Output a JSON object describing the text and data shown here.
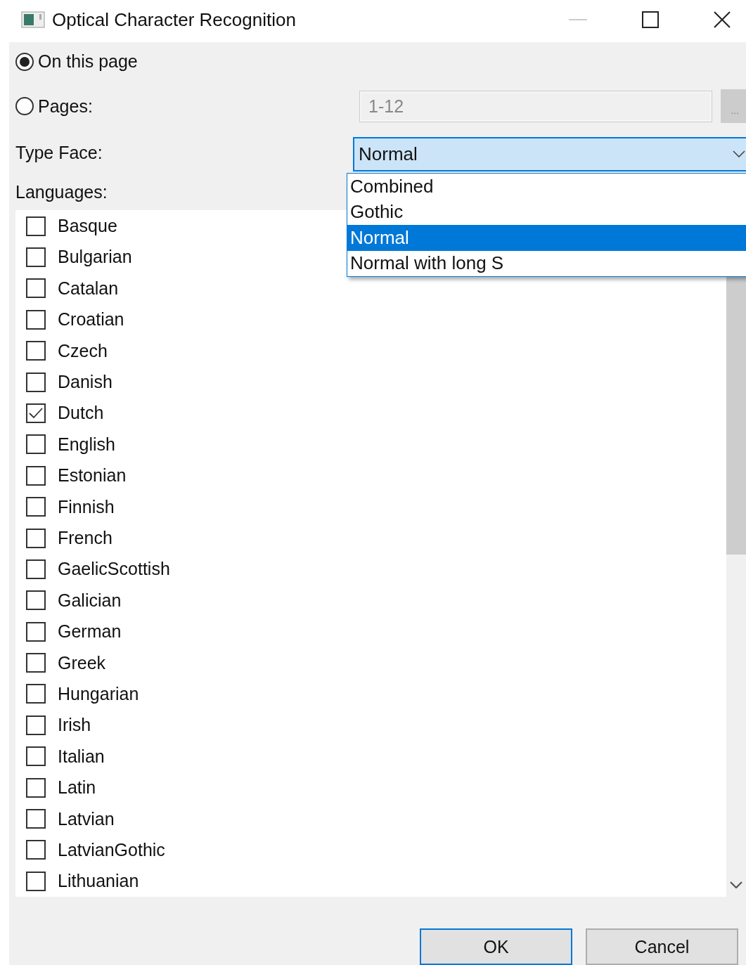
{
  "window": {
    "title": "Optical Character Recognition"
  },
  "scope": [
    {
      "label": "On this page",
      "selected": true
    },
    {
      "label": "Pages:",
      "selected": false
    }
  ],
  "pages_field": {
    "value": "1-12",
    "disabled": true
  },
  "pages_browse_button": "...",
  "type_face": {
    "label": "Type Face:",
    "value": "Normal",
    "expanded": true,
    "options": [
      {
        "label": "Combined",
        "selected": false
      },
      {
        "label": "Gothic",
        "selected": false
      },
      {
        "label": "Normal",
        "selected": true
      },
      {
        "label": "Normal with long S",
        "selected": false
      }
    ]
  },
  "languages": {
    "label": "Languages:",
    "items": [
      {
        "label": "Basque",
        "checked": false
      },
      {
        "label": "Bulgarian",
        "checked": false
      },
      {
        "label": "Catalan",
        "checked": false
      },
      {
        "label": "Croatian",
        "checked": false
      },
      {
        "label": "Czech",
        "checked": false
      },
      {
        "label": "Danish",
        "checked": false
      },
      {
        "label": "Dutch",
        "checked": true
      },
      {
        "label": "English",
        "checked": false
      },
      {
        "label": "Estonian",
        "checked": false
      },
      {
        "label": "Finnish",
        "checked": false
      },
      {
        "label": "French",
        "checked": false
      },
      {
        "label": "GaelicScottish",
        "checked": false
      },
      {
        "label": "Galician",
        "checked": false
      },
      {
        "label": "German",
        "checked": false
      },
      {
        "label": "Greek",
        "checked": false
      },
      {
        "label": "Hungarian",
        "checked": false
      },
      {
        "label": "Irish",
        "checked": false
      },
      {
        "label": "Italian",
        "checked": false
      },
      {
        "label": "Latin",
        "checked": false
      },
      {
        "label": "Latvian",
        "checked": false
      },
      {
        "label": "LatvianGothic",
        "checked": false
      },
      {
        "label": "Lithuanian",
        "checked": false
      }
    ]
  },
  "buttons": [
    {
      "label": "OK",
      "default": true
    },
    {
      "label": "Cancel",
      "default": false
    }
  ]
}
